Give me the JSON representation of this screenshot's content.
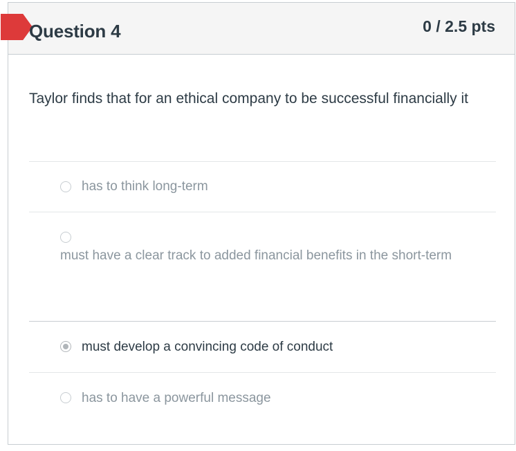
{
  "question": {
    "title": "Question 4",
    "points": "0 / 2.5 pts",
    "text": "Taylor finds that for an ethical company to be successful financially it"
  },
  "answers": [
    {
      "label": "has to think long-term",
      "selected": false
    },
    {
      "label": "must have a clear track to added financial benefits in the short-term",
      "selected": false
    },
    {
      "label": "must develop a convincing code of conduct",
      "selected": true
    },
    {
      "label": "has to have a powerful message",
      "selected": false
    }
  ],
  "colors": {
    "flag": "#dd3a3a",
    "text": "#2d3b45",
    "muted_text": "#8b969e",
    "border": "#c7cdd1"
  },
  "icons": {
    "flag": "bookmark-flag-icon",
    "radio": "radio-button-icon"
  }
}
